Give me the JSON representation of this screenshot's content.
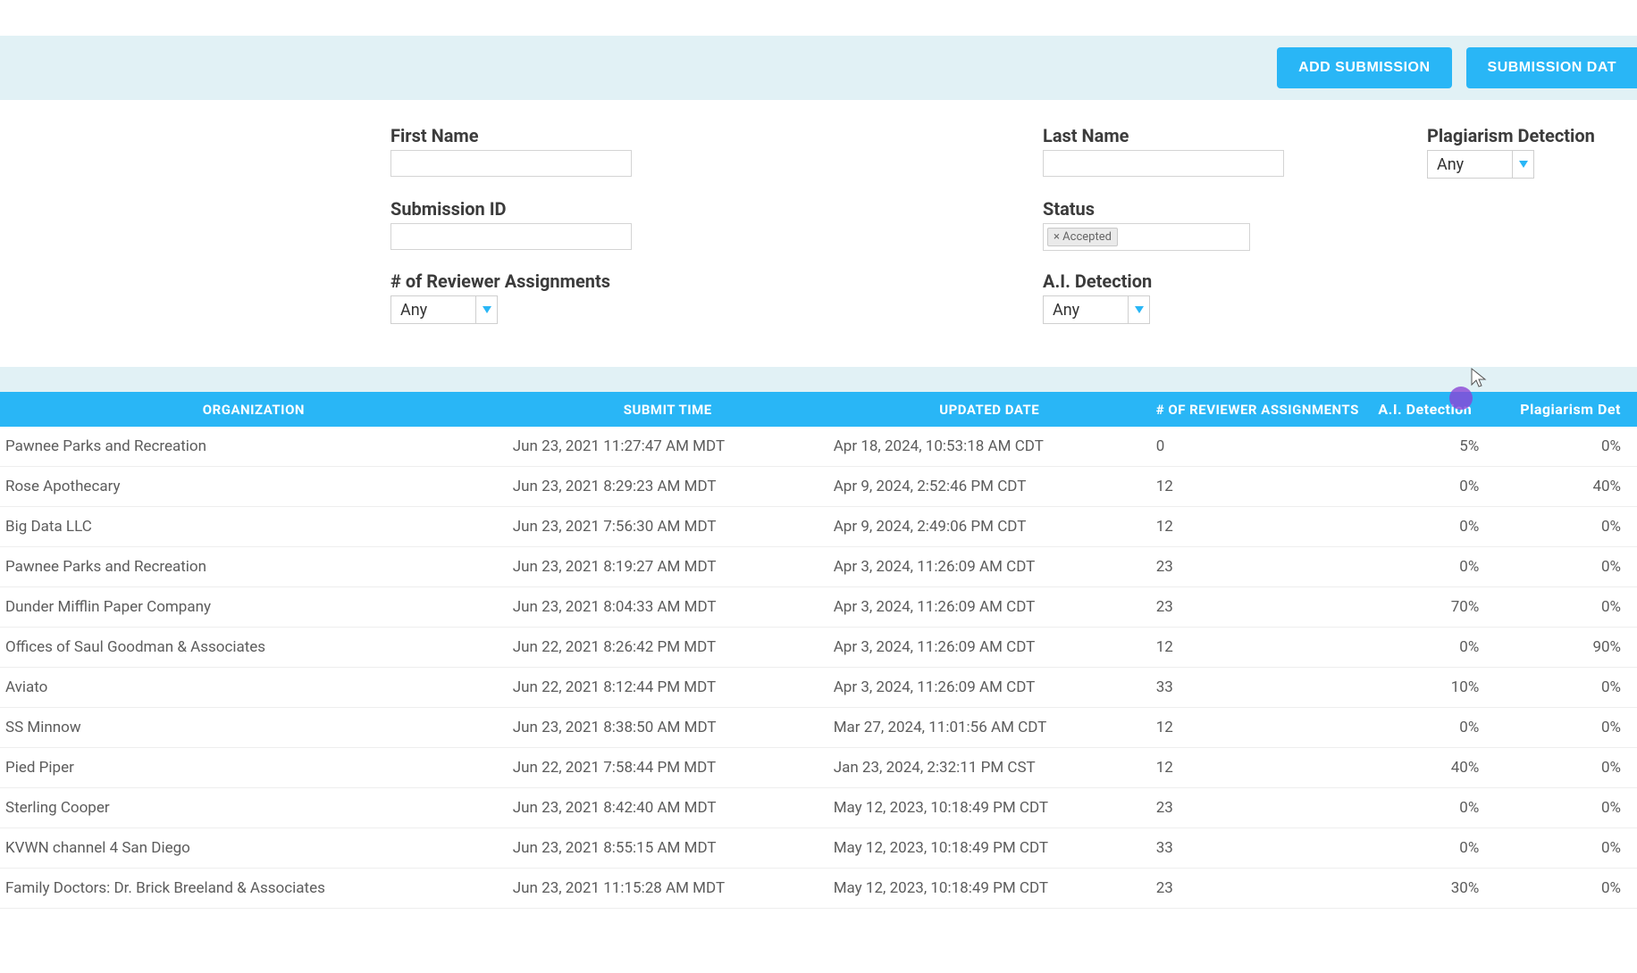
{
  "actions": {
    "add_submission": "ADD SUBMISSION",
    "submission_data": "SUBMISSION DAT"
  },
  "filters": {
    "first_name": {
      "label": "First Name",
      "value": ""
    },
    "last_name": {
      "label": "Last Name",
      "value": ""
    },
    "plagiarism_detection": {
      "label": "Plagiarism Detection",
      "value": "Any"
    },
    "submission_id": {
      "label": "Submission ID",
      "value": ""
    },
    "status": {
      "label": "Status",
      "tag": "× Accepted"
    },
    "reviewer_assignments": {
      "label": "# of Reviewer Assignments",
      "value": "Any"
    },
    "ai_detection": {
      "label": "A.I. Detection",
      "value": "Any"
    }
  },
  "table": {
    "headers": {
      "organization": "ORGANIZATION",
      "submit_time": "SUBMIT TIME",
      "updated_date": "UPDATED DATE",
      "reviewer_assignments": "# OF REVIEWER ASSIGNMENTS",
      "ai_detection": "A.I. Detection",
      "plagiarism_detection": "Plagiarism Det"
    },
    "rows": [
      {
        "organization": "Pawnee Parks and Recreation",
        "submit_time": "Jun 23, 2021 11:27:47 AM MDT",
        "updated_date": "Apr 18, 2024, 10:53:18 AM CDT",
        "reviewer_assignments": "0",
        "ai_detection": "5%",
        "plag": "0%"
      },
      {
        "organization": "Rose Apothecary",
        "submit_time": "Jun 23, 2021 8:29:23 AM MDT",
        "updated_date": "Apr 9, 2024, 2:52:46 PM CDT",
        "reviewer_assignments": "12",
        "ai_detection": "0%",
        "plag": "40%"
      },
      {
        "organization": "Big Data LLC",
        "submit_time": "Jun 23, 2021 7:56:30 AM MDT",
        "updated_date": "Apr 9, 2024, 2:49:06 PM CDT",
        "reviewer_assignments": "12",
        "ai_detection": "0%",
        "plag": "0%"
      },
      {
        "organization": "Pawnee Parks and Recreation",
        "submit_time": "Jun 23, 2021 8:19:27 AM MDT",
        "updated_date": "Apr 3, 2024, 11:26:09 AM CDT",
        "reviewer_assignments": "23",
        "ai_detection": "0%",
        "plag": "0%"
      },
      {
        "organization": "Dunder Mifflin Paper Company",
        "submit_time": "Jun 23, 2021 8:04:33 AM MDT",
        "updated_date": "Apr 3, 2024, 11:26:09 AM CDT",
        "reviewer_assignments": "23",
        "ai_detection": "70%",
        "plag": "0%"
      },
      {
        "organization": "Offices of Saul Goodman & Associates",
        "submit_time": "Jun 22, 2021 8:26:42 PM MDT",
        "updated_date": "Apr 3, 2024, 11:26:09 AM CDT",
        "reviewer_assignments": "12",
        "ai_detection": "0%",
        "plag": "90%"
      },
      {
        "organization": "Aviato",
        "submit_time": "Jun 22, 2021 8:12:44 PM MDT",
        "updated_date": "Apr 3, 2024, 11:26:09 AM CDT",
        "reviewer_assignments": "33",
        "ai_detection": "10%",
        "plag": "0%"
      },
      {
        "organization": "SS Minnow",
        "submit_time": "Jun 23, 2021 8:38:50 AM MDT",
        "updated_date": "Mar 27, 2024, 11:01:56 AM CDT",
        "reviewer_assignments": "12",
        "ai_detection": "0%",
        "plag": "0%"
      },
      {
        "organization": "Pied Piper",
        "submit_time": "Jun 22, 2021 7:58:44 PM MDT",
        "updated_date": "Jan 23, 2024, 2:32:11 PM CST",
        "reviewer_assignments": "12",
        "ai_detection": "40%",
        "plag": "0%"
      },
      {
        "organization": "Sterling Cooper",
        "submit_time": "Jun 23, 2021 8:42:40 AM MDT",
        "updated_date": "May 12, 2023, 10:18:49 PM CDT",
        "reviewer_assignments": "23",
        "ai_detection": "0%",
        "plag": "0%"
      },
      {
        "organization": "KVWN channel 4 San Diego",
        "submit_time": "Jun 23, 2021 8:55:15 AM MDT",
        "updated_date": "May 12, 2023, 10:18:49 PM CDT",
        "reviewer_assignments": "33",
        "ai_detection": "0%",
        "plag": "0%"
      },
      {
        "organization": "Family Doctors: Dr. Brick Breeland & Associates",
        "submit_time": "Jun 23, 2021 11:15:28 AM MDT",
        "updated_date": "May 12, 2023, 10:18:49 PM CDT",
        "reviewer_assignments": "23",
        "ai_detection": "30%",
        "plag": "0%"
      }
    ]
  }
}
